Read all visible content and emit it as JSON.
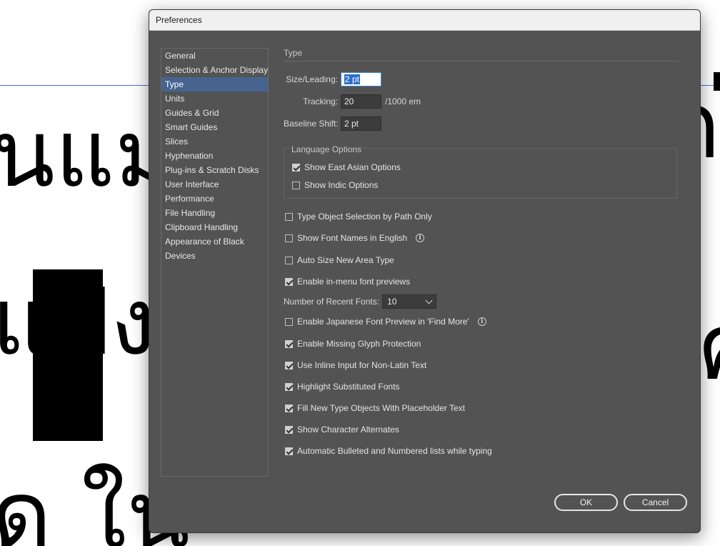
{
  "background": {
    "thai_line_1": "นแมา",
    "thai_line_2": "แป้ง",
    "thai_line_3": "ด ใน",
    "thai_right_1": "ก",
    "thai_right_2": "ค"
  },
  "dialog": {
    "title": "Preferences",
    "sidebar": {
      "items": [
        {
          "label": "General"
        },
        {
          "label": "Selection & Anchor Display"
        },
        {
          "label": "Type",
          "selected": true
        },
        {
          "label": "Units"
        },
        {
          "label": "Guides & Grid"
        },
        {
          "label": "Smart Guides"
        },
        {
          "label": "Slices"
        },
        {
          "label": "Hyphenation"
        },
        {
          "label": "Plug-ins & Scratch Disks"
        },
        {
          "label": "User Interface"
        },
        {
          "label": "Performance"
        },
        {
          "label": "File Handling"
        },
        {
          "label": "Clipboard Handling"
        },
        {
          "label": "Appearance of Black"
        },
        {
          "label": "Devices"
        }
      ]
    },
    "panel": {
      "section_title": "Type",
      "size_leading": {
        "label": "Size/Leading:",
        "value": "2 pt"
      },
      "tracking": {
        "label": "Tracking:",
        "value": "20",
        "unit": "/1000 em"
      },
      "baseline_shift": {
        "label": "Baseline Shift:",
        "value": "2 pt"
      },
      "language_options": {
        "title": "Language Options",
        "show_east_asian": {
          "label": "Show East Asian Options",
          "checked": true
        },
        "show_indic": {
          "label": "Show Indic Options",
          "checked": false
        }
      },
      "type_object_selection": {
        "label": "Type Object Selection by Path Only",
        "checked": false
      },
      "show_font_names_english": {
        "label": "Show Font Names in English",
        "checked": false
      },
      "auto_size_area_type": {
        "label": "Auto Size New Area Type",
        "checked": false
      },
      "in_menu_font_previews": {
        "label": "Enable in-menu font previews",
        "checked": true
      },
      "recent_fonts": {
        "label": "Number of Recent Fonts:",
        "value": "10"
      },
      "japanese_font_preview": {
        "label": "Enable Japanese Font Preview in 'Find More'",
        "checked": false
      },
      "missing_glyph_protection": {
        "label": "Enable Missing Glyph Protection",
        "checked": true
      },
      "inline_input": {
        "label": "Use Inline Input for Non-Latin Text",
        "checked": true
      },
      "highlight_substituted": {
        "label": "Highlight Substituted Fonts",
        "checked": true
      },
      "placeholder_text": {
        "label": "Fill New Type Objects With Placeholder Text",
        "checked": true
      },
      "character_alternates": {
        "label": "Show Character Alternates",
        "checked": true
      },
      "auto_bulleted_lists": {
        "label": "Automatic Bulleted and Numbered lists while typing",
        "checked": true
      }
    },
    "buttons": {
      "ok": "OK",
      "cancel": "Cancel"
    }
  }
}
